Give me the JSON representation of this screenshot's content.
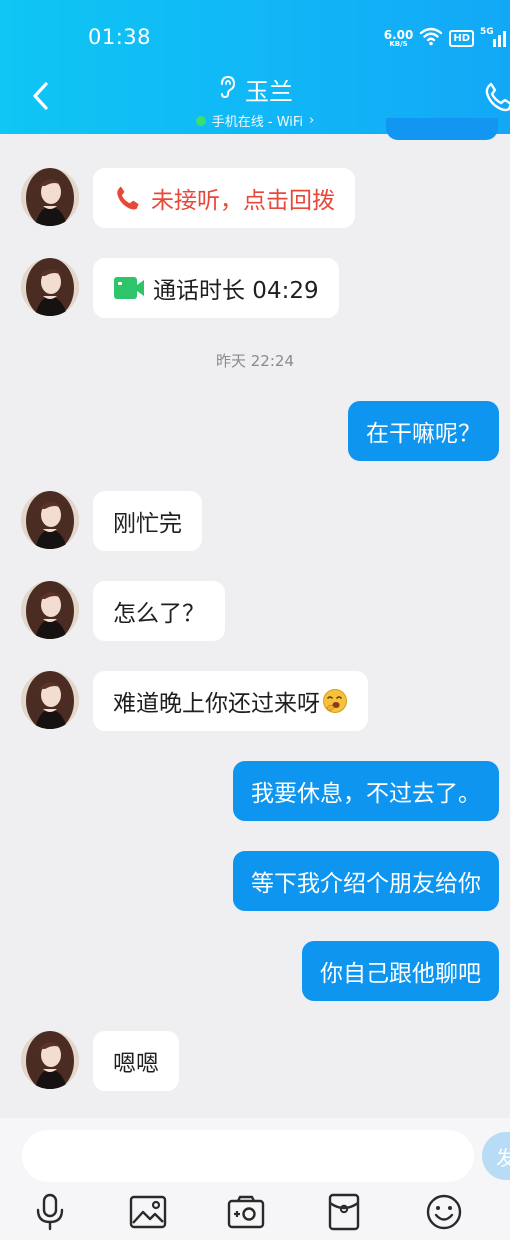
{
  "status_bar": {
    "time": "01:38",
    "net_speed_value": "6.00",
    "net_speed_unit": "KB/S",
    "hd_label": "HD",
    "network_label": "5G"
  },
  "header": {
    "contact_name": "玉兰",
    "subtitle": "手机在线 - WiFi",
    "subtitle_chevron": "›"
  },
  "messages": [
    {
      "direction": "in",
      "type": "missed_call",
      "icon": "phone-icon",
      "text": "未接听，点击回拨"
    },
    {
      "direction": "in",
      "type": "video_call",
      "icon": "video-icon",
      "text": "通话时长 04:29"
    },
    {
      "type": "time_separator",
      "text": "昨天 22:24"
    },
    {
      "direction": "out",
      "text": "在干嘛呢？"
    },
    {
      "direction": "in",
      "text": "刚忙完"
    },
    {
      "direction": "in",
      "text": "怎么了？"
    },
    {
      "direction": "in",
      "text": "难道晚上你还过来呀",
      "emoji": "yawning-face"
    },
    {
      "direction": "out",
      "text": "我要休息，不过去了。"
    },
    {
      "direction": "out",
      "text": "等下我介绍个朋友给你"
    },
    {
      "direction": "out",
      "text": "你自己跟他聊吧"
    },
    {
      "direction": "in",
      "text": "嗯嗯"
    }
  ],
  "input": {
    "placeholder": "",
    "send_label": "发"
  },
  "toolbar": {
    "icons": [
      "microphone-icon",
      "photo-icon",
      "camera-icon",
      "red-packet-icon",
      "emoji-icon"
    ]
  },
  "colors": {
    "header_gradient_start": "#0fc6f4",
    "header_gradient_end": "#12a8f6",
    "outgoing_bubble": "#0d95f0",
    "incoming_bubble": "#ffffff",
    "missed_call_red": "#e8483a",
    "video_call_green": "#2ec56a",
    "chat_background": "#efeff1"
  }
}
